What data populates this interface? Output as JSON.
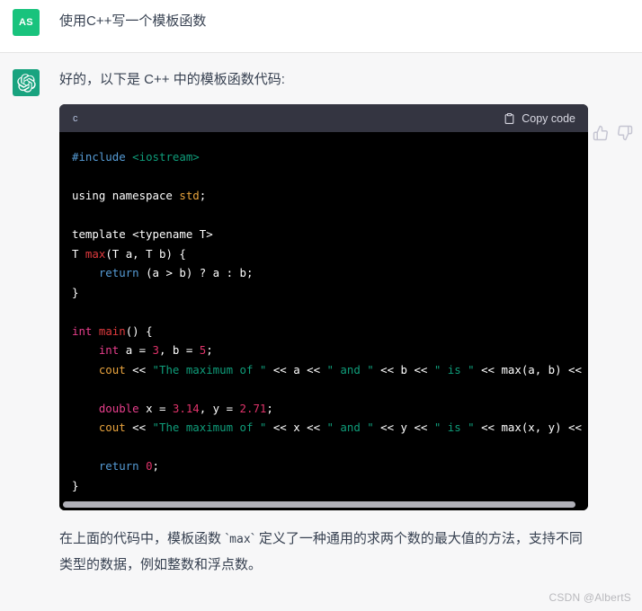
{
  "user_message": {
    "avatar_initials": "AS",
    "avatar_color": "#19c37d",
    "text": "使用C++写一个模板函数"
  },
  "assistant_message": {
    "avatar_icon": "openai-logo-icon",
    "avatar_color": "#19a37f",
    "intro_text": "好的，以下是 C++ 中的模板函数代码:",
    "closing_text_part1": "在上面的代码中，模板函数 `",
    "closing_inline_code": "max",
    "closing_text_part2": "` 定义了一种通用的求两个数的最大值的方法，支持不同类型的数据，例如整数和浮点数。"
  },
  "feedback": {
    "thumbs_up_icon": "thumbs-up-icon",
    "thumbs_down_icon": "thumbs-down-icon",
    "icon_color": "#c5c5d2"
  },
  "code_block": {
    "language_label": "c",
    "copy_label": "Copy code",
    "copy_icon": "clipboard-icon",
    "header_bg": "#343541",
    "body_bg": "#000000",
    "scrollbar_visible": true,
    "code_lines": [
      "#include <iostream>",
      "",
      "using namespace std;",
      "",
      "template <typename T>",
      "T max(T a, T b) {",
      "    return (a > b) ? a : b;",
      "}",
      "",
      "int main() {",
      "    int a = 3, b = 5;",
      "    cout << \"The maximum of \" << a << \" and \" << b << \" is \" << max(a, b) << endl;",
      "",
      "    double x = 3.14, y = 2.71;",
      "    cout << \"The maximum of \" << x << \" and \" << y << \" is \" << max(x, y) << endl;",
      "",
      "    return 0;",
      "}"
    ],
    "syntax_colors": {
      "preprocessor": "#569cd6",
      "header_name": "#0f9d7a",
      "keyword": "#569cd6",
      "function": "#e03a3e",
      "type": "#e83e8c",
      "number": "#e0336a",
      "string": "#0f9d7a",
      "stream": "#e8a33d",
      "plain": "#ffffff"
    }
  },
  "watermark": {
    "text": "CSDN @AlbertS"
  }
}
